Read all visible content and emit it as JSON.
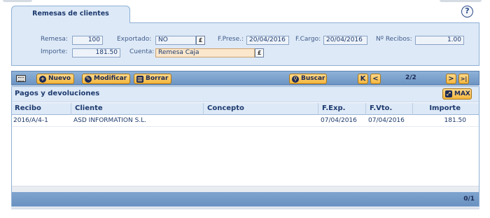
{
  "tab": {
    "label": "Remesas de clientes"
  },
  "help": {
    "glyph": "?"
  },
  "form": {
    "remesa": {
      "label": "Remesa:",
      "value": "100"
    },
    "exportado": {
      "label": "Exportado:",
      "value": "NO"
    },
    "fprese": {
      "label": "F.Prese.:",
      "value": "20/04/2016"
    },
    "fcargo": {
      "label": "F.Cargo:",
      "value": "20/04/2016"
    },
    "nrecibos": {
      "label": "Nº Recibos:",
      "value": "1.00"
    },
    "importe": {
      "label": "Importe:",
      "value": "181.50"
    },
    "cuenta": {
      "label": "Cuenta:",
      "value": "Remesa Caja"
    }
  },
  "toolbar": {
    "nuevo": "Nuevo",
    "modificar": "Modificar",
    "borrar": "Borrar",
    "buscar": "Buscar",
    "pager": "2/2",
    "first": "K",
    "prev": "<",
    "next": ">",
    "last": ">|"
  },
  "grid": {
    "title": "Pagos y devoluciones",
    "max_label": "MAX",
    "columns": [
      "Recibo",
      "Cliente",
      "Concepto",
      "F.Exp.",
      "F.Vto.",
      "Importe"
    ],
    "rows": [
      [
        "2016/A/4-1",
        "ASD INFORMATION S.L.",
        "",
        "07/04/2016",
        "07/04/2016",
        "181.50"
      ]
    ],
    "count": "0/1"
  },
  "colors": {
    "accent": "#f4b63c",
    "panel": "#dde9f7",
    "toolbar": "#7fa4cf"
  }
}
